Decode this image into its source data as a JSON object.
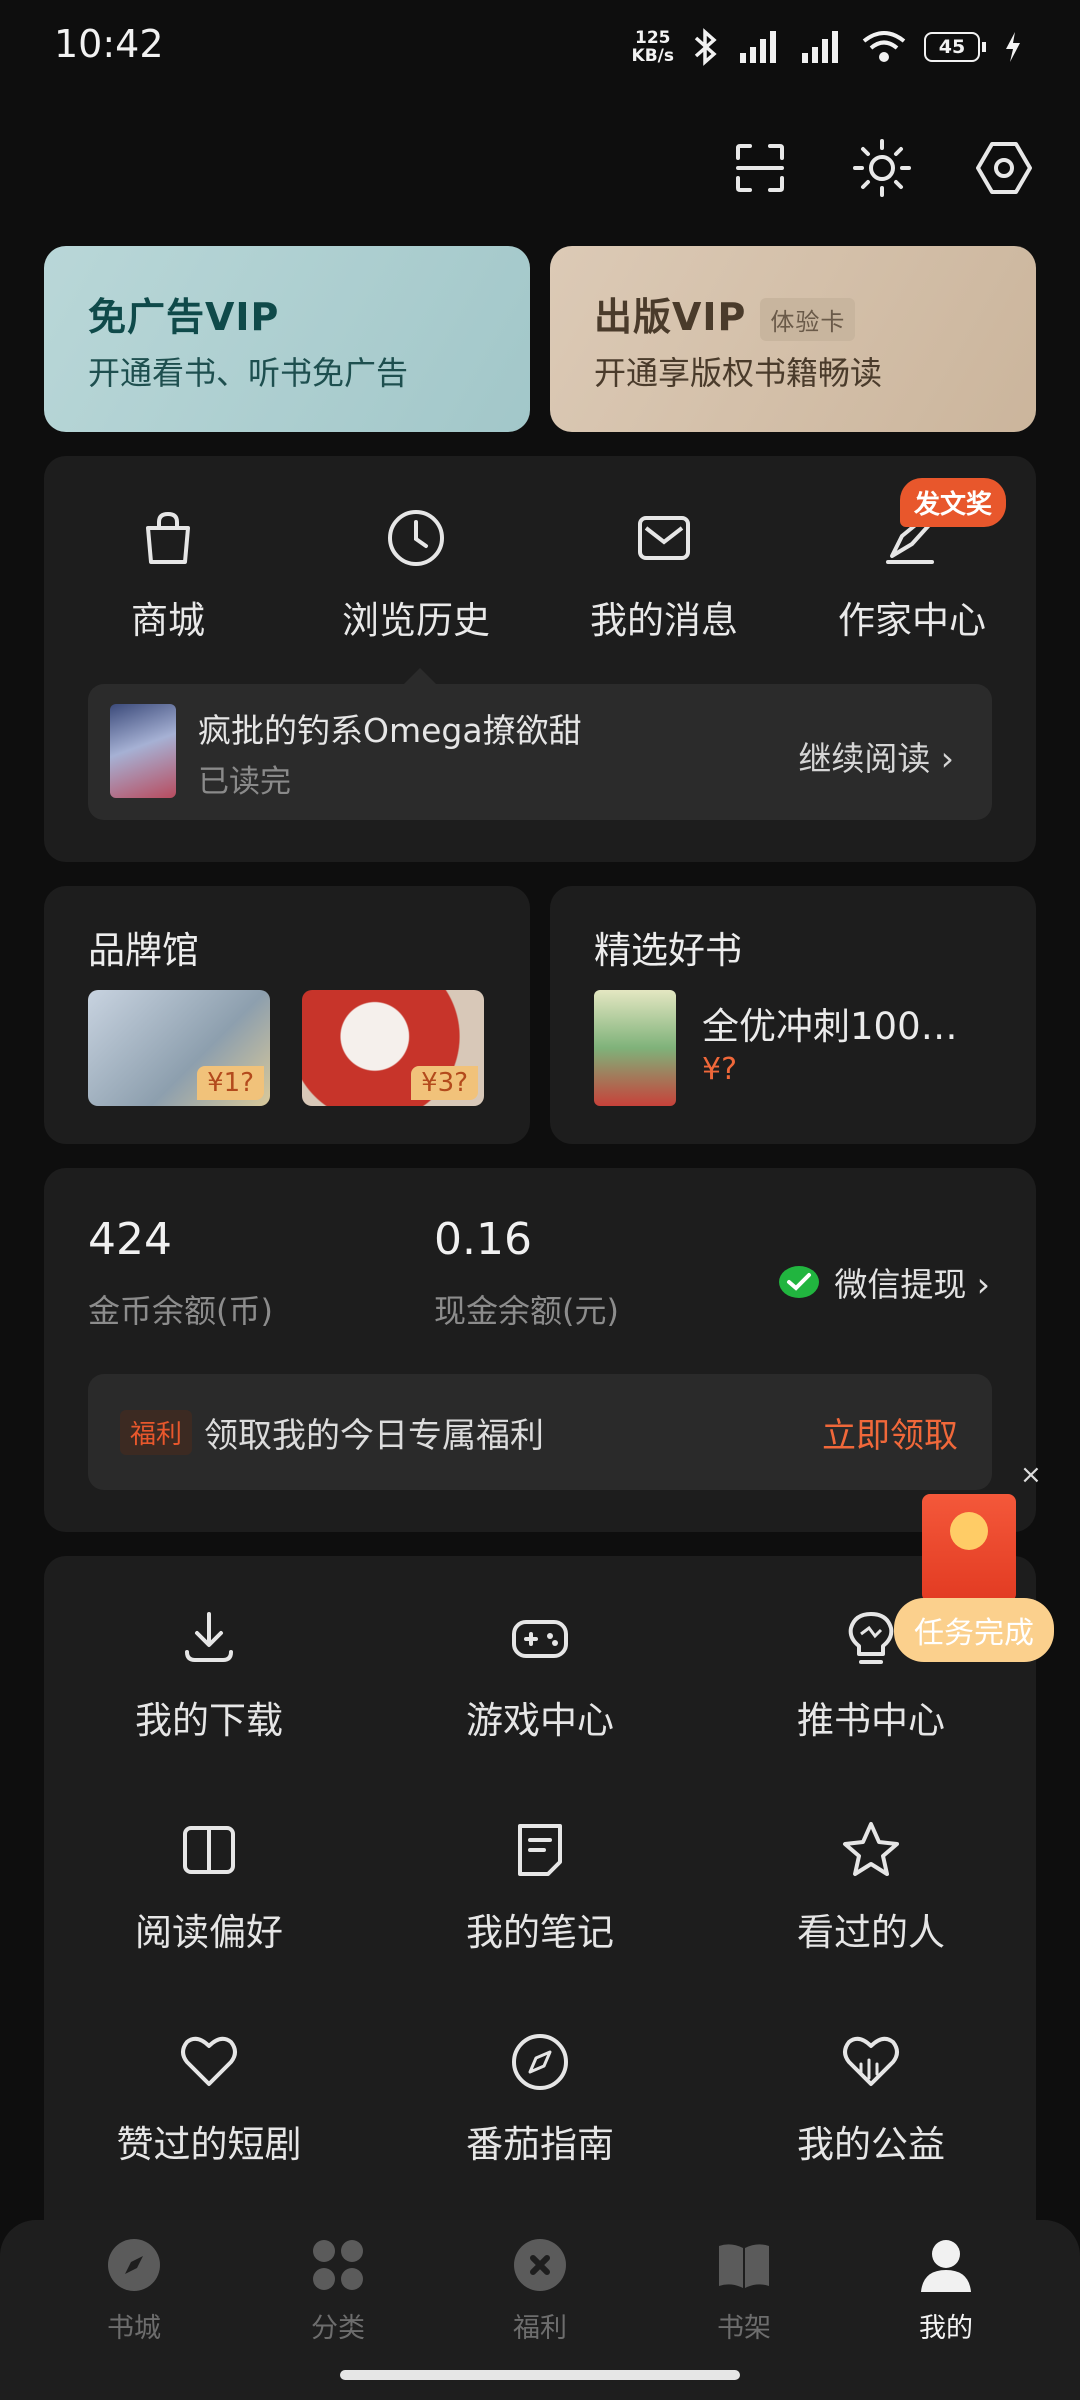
{
  "status": {
    "time": "10:42",
    "speed_top": "125",
    "speed_bottom": "KB/s",
    "battery": "45"
  },
  "vip": {
    "ad_free": {
      "title": "免广告VIP",
      "subtitle": "开通看书、听书免广告"
    },
    "publish": {
      "title": "出版VIP",
      "tag": "体验卡",
      "subtitle": "开通享版权书籍畅读"
    }
  },
  "quick": {
    "items": [
      {
        "label": "商城",
        "icon": "shopping-bag-icon"
      },
      {
        "label": "浏览历史",
        "icon": "clock-icon"
      },
      {
        "label": "我的消息",
        "icon": "mail-icon"
      },
      {
        "label": "作家中心",
        "icon": "pen-icon"
      }
    ],
    "writer_badge": "发文奖",
    "recent": {
      "title": "疯批的钓系Omega撩欲甜",
      "status": "已读完",
      "action": "继续阅读 ›"
    }
  },
  "brand": {
    "title": "品牌馆",
    "items": [
      {
        "price": "¥1?"
      },
      {
        "price": "¥3?"
      }
    ]
  },
  "goodbook": {
    "title": "精选好书",
    "name": "全优冲刺100…",
    "price": "¥?"
  },
  "wallet": {
    "coins": "424",
    "coins_label": "金币余额(币)",
    "cash": "0.16",
    "cash_label": "现金余额(元)",
    "withdraw": "微信提现 ›",
    "welfare_tag": "福利",
    "welfare_text": "领取我的今日专属福利",
    "welfare_action": "立即领取"
  },
  "grid": [
    {
      "label": "我的下载",
      "icon": "download-icon"
    },
    {
      "label": "游戏中心",
      "icon": "gamepad-icon"
    },
    {
      "label": "推书中心",
      "icon": "bulb-icon"
    },
    {
      "label": "阅读偏好",
      "icon": "book-icon"
    },
    {
      "label": "我的笔记",
      "icon": "note-icon"
    },
    {
      "label": "看过的人",
      "icon": "star-icon"
    },
    {
      "label": "赞过的短剧",
      "icon": "heart-icon"
    },
    {
      "label": "番茄指南",
      "icon": "compass-icon"
    },
    {
      "label": "我的公益",
      "icon": "charity-heart-icon"
    }
  ],
  "float": {
    "task": "任务完成",
    "close": "×"
  },
  "tabs": [
    {
      "label": "书城",
      "icon": "compass-tab-icon"
    },
    {
      "label": "分类",
      "icon": "grid-icon"
    },
    {
      "label": "福利",
      "icon": "gift-icon"
    },
    {
      "label": "书架",
      "icon": "bookshelf-icon"
    },
    {
      "label": "我的",
      "icon": "person-icon"
    }
  ],
  "colors": {
    "accent": "#f0683a",
    "card": "#1d1d1d",
    "background": "#0e0e0e"
  }
}
